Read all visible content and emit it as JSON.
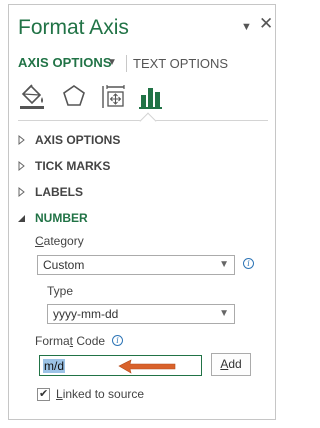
{
  "panel": {
    "title": "Format Axis",
    "dropdown_icon": "▼",
    "close_icon": "✕"
  },
  "tabs": {
    "axis_options": "AXIS OPTIONS",
    "text_options": "TEXT OPTIONS"
  },
  "icon_bar": [
    "fill-line-icon",
    "effects-pentagon-icon",
    "size-properties-icon",
    "axis-options-chart-icon"
  ],
  "sections": [
    {
      "label": "AXIS OPTIONS",
      "expanded": false
    },
    {
      "label": "TICK MARKS",
      "expanded": false
    },
    {
      "label": "LABELS",
      "expanded": false
    },
    {
      "label": "NUMBER",
      "expanded": true
    }
  ],
  "number": {
    "category_label_accel": "C",
    "category_label_rest": "ategory",
    "category_value": "Custom",
    "type_label": "Type",
    "type_value": "yyyy-mm-dd",
    "format_code_label_pre": "Forma",
    "format_code_label_accel": "t",
    "format_code_label_post": " Code",
    "format_code_value": "m/d",
    "add_button_accel": "A",
    "add_button_rest": "dd",
    "linked_accel": "L",
    "linked_rest": "inked to source",
    "linked_checked": true
  },
  "colors": {
    "accent": "#217346",
    "arrow": "#d9622b"
  }
}
